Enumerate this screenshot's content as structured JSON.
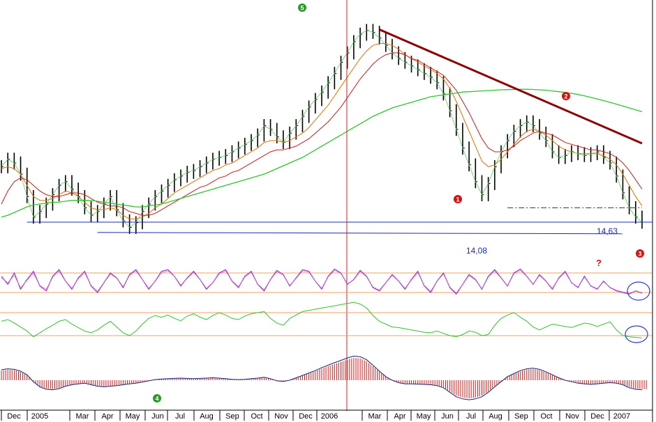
{
  "chart_data": [
    {
      "type": "line",
      "panel": "price",
      "x_axis": [
        "Dec",
        "2005",
        "Mar",
        "Apr",
        "May",
        "Jun",
        "Jul",
        "Aug",
        "Sep",
        "Oct",
        "Nov",
        "Dec",
        "2006",
        "Mar",
        "Apr",
        "May",
        "Jun",
        "Jul",
        "Aug",
        "Sep",
        "Oct",
        "Nov",
        "Dec",
        "2007"
      ],
      "series": [
        {
          "values": [
            17.6,
            18.0,
            17.8,
            17.2,
            16.0,
            14.9,
            15.2,
            15.6,
            16.1,
            16.6,
            16.8,
            16.4,
            16.0,
            15.4,
            15.0,
            15.2,
            15.6,
            16.0,
            15.3,
            14.7,
            14.35,
            14.6,
            15.2,
            15.6,
            16.0,
            16.3,
            16.6,
            16.9,
            17.1,
            17.3,
            17.4,
            17.6,
            17.8,
            18.0,
            18.1,
            18.2,
            18.4,
            18.6,
            18.8,
            19.0,
            19.3,
            19.8,
            19.6,
            19.2,
            18.9,
            19.4,
            19.8,
            20.3,
            20.8,
            21.2,
            21.6,
            22.1,
            22.6,
            23.2,
            23.7,
            24.3,
            24.7,
            24.9,
            24.8,
            24.5,
            24.1,
            23.7,
            23.4,
            23.2,
            23.0,
            22.8,
            22.6,
            22.4,
            22.1,
            21.5,
            20.6,
            19.6,
            18.6,
            17.7,
            16.8,
            16.1,
            16.7,
            17.6,
            18.4,
            19.0,
            19.5,
            19.8,
            20.0,
            19.8,
            19.4,
            19.0,
            18.4,
            18.1,
            18.2,
            18.4,
            18.3,
            18.2,
            18.3,
            18.4,
            18.1,
            17.8,
            17.1,
            16.2,
            15.4,
            14.9,
            14.63
          ]
        },
        {
          "values": [
            17.5,
            17.6,
            17.5,
            17.2,
            16.6,
            16.0,
            15.8,
            15.8,
            15.9,
            16.1,
            16.3,
            16.2,
            16.0,
            15.7,
            15.4,
            15.3,
            15.3,
            15.4,
            15.3,
            15.0,
            14.8,
            14.8,
            14.9,
            15.1,
            15.4,
            15.6,
            15.9,
            16.2,
            16.4,
            16.6,
            16.8,
            17.0,
            17.2,
            17.4,
            17.5,
            17.7,
            17.8,
            18.0,
            18.2,
            18.4,
            18.6,
            18.9,
            19.0,
            19.0,
            18.9,
            19.0,
            19.2,
            19.4,
            19.7,
            20.1,
            20.5,
            20.9,
            21.4,
            21.9,
            22.4,
            22.9,
            23.4,
            23.8,
            24.1,
            24.2,
            24.2,
            24.1,
            23.9,
            23.6,
            23.4,
            23.2,
            23.0,
            22.8,
            22.6,
            22.3,
            21.8,
            21.1,
            20.3,
            19.5,
            18.7,
            17.9,
            17.6,
            17.7,
            18.0,
            18.4,
            18.8,
            19.2,
            19.5,
            19.6,
            19.5,
            19.3,
            19.0,
            18.7,
            18.5,
            18.4,
            18.3,
            18.3,
            18.3,
            18.3,
            18.2,
            18.0,
            17.7,
            17.2,
            16.6,
            16.0,
            15.5
          ]
        },
        {
          "values": [
            15.6,
            16.3,
            16.8,
            17.0,
            16.9,
            16.6,
            16.3,
            16.1,
            16.0,
            16.0,
            16.1,
            16.2,
            16.2,
            16.1,
            15.9,
            15.7,
            15.6,
            15.5,
            15.5,
            15.4,
            15.2,
            15.1,
            15.0,
            15.0,
            15.1,
            15.3,
            15.5,
            15.7,
            15.9,
            16.1,
            16.3,
            16.5,
            16.6,
            16.8,
            17.0,
            17.1,
            17.3,
            17.4,
            17.6,
            17.8,
            18.0,
            18.2,
            18.4,
            18.5,
            18.5,
            18.6,
            18.7,
            18.9,
            19.1,
            19.4,
            19.7,
            20.0,
            20.4,
            20.8,
            21.3,
            21.8,
            22.3,
            22.7,
            23.1,
            23.4,
            23.6,
            23.7,
            23.7,
            23.6,
            23.4,
            23.3,
            23.1,
            22.9,
            22.7,
            22.5,
            22.1,
            21.7,
            21.1,
            20.5,
            19.8,
            19.1,
            18.6,
            18.4,
            18.4,
            18.5,
            18.7,
            19.0,
            19.2,
            19.4,
            19.5,
            19.4,
            19.3,
            19.1,
            18.9,
            18.8,
            18.7,
            18.6,
            18.5,
            18.5,
            18.4,
            18.3,
            18.1,
            17.8,
            17.4,
            16.9,
            16.4
          ]
        },
        {
          "values": [
            14.9,
            15.0,
            15.15,
            15.3,
            15.45,
            15.55,
            15.6,
            15.65,
            15.7,
            15.7,
            15.75,
            15.8,
            15.8,
            15.8,
            15.8,
            15.75,
            15.7,
            15.65,
            15.6,
            15.55,
            15.5,
            15.45,
            15.45,
            15.5,
            15.55,
            15.6,
            15.7,
            15.8,
            15.9,
            16.0,
            16.1,
            16.2,
            16.3,
            16.4,
            16.5,
            16.6,
            16.7,
            16.8,
            16.9,
            17.0,
            17.1,
            17.2,
            17.35,
            17.5,
            17.65,
            17.8,
            17.95,
            18.1,
            18.3,
            18.5,
            18.7,
            18.9,
            19.1,
            19.3,
            19.5,
            19.7,
            19.9,
            20.1,
            20.3,
            20.45,
            20.6,
            20.75,
            20.85,
            20.95,
            21.05,
            21.15,
            21.25,
            21.35,
            21.4,
            21.45,
            21.5,
            21.55,
            21.6,
            21.62,
            21.64,
            21.66,
            21.68,
            21.7,
            21.72,
            21.73,
            21.74,
            21.75,
            21.75,
            21.74,
            21.72,
            21.7,
            21.66,
            21.62,
            21.58,
            21.53,
            21.47,
            21.4,
            21.32,
            21.23,
            21.14,
            21.05,
            20.95,
            20.85,
            20.75,
            20.65,
            20.55
          ]
        }
      ],
      "ylim": [
        13.4,
        25.6
      ],
      "horizontal_levels": [
        {
          "label": "14,63",
          "value": 14.63
        },
        {
          "label": "14,08",
          "value": 14.08
        }
      ],
      "trendline": {
        "from": {
          "x_index": 59,
          "y": 24.95
        },
        "to": {
          "x_index": 100,
          "y": 18.85
        }
      },
      "support_dashed": {
        "from_x_index": 79,
        "to_x_index": 100,
        "y": 15.4
      },
      "annotations": [
        {
          "label": "1",
          "kind": "red-marker"
        },
        {
          "label": "2",
          "kind": "red-marker"
        },
        {
          "label": "3",
          "kind": "red-marker"
        },
        {
          "label": "5",
          "kind": "green-marker"
        },
        {
          "label": "?",
          "kind": "red-text"
        }
      ]
    },
    {
      "type": "line",
      "panel": "stochastic",
      "ylim": [
        0,
        100
      ],
      "reference_levels": [
        80,
        20
      ],
      "series": [
        {
          "values": [
            70,
            45,
            80,
            30,
            60,
            85,
            40,
            25,
            70,
            90,
            55,
            30,
            65,
            85,
            40,
            20,
            50,
            80,
            65,
            35,
            75,
            90,
            60,
            30,
            55,
            85,
            90,
            70,
            40,
            65,
            85,
            60,
            30,
            50,
            80,
            90,
            55,
            35,
            70,
            85,
            45,
            25,
            60,
            88,
            75,
            40,
            65,
            90,
            85,
            55,
            30,
            70,
            92,
            80,
            45,
            60,
            88,
            70,
            35,
            25,
            50,
            75,
            55,
            30,
            60,
            85,
            40,
            20,
            55,
            80,
            35,
            15,
            45,
            75,
            60,
            30,
            70,
            90,
            65,
            40,
            80,
            92,
            70,
            45,
            75,
            55,
            30,
            65,
            85,
            50,
            35,
            70,
            40,
            30,
            55,
            35,
            25,
            20,
            15,
            25,
            18
          ]
        },
        {
          "values": [
            65,
            50,
            72,
            35,
            57,
            78,
            42,
            30,
            66,
            85,
            55,
            33,
            62,
            80,
            42,
            24,
            50,
            76,
            64,
            38,
            72,
            86,
            60,
            33,
            54,
            81,
            86,
            70,
            43,
            63,
            81,
            60,
            33,
            50,
            77,
            86,
            56,
            38,
            67,
            81,
            46,
            29,
            59,
            84,
            73,
            42,
            63,
            86,
            82,
            55,
            33,
            68,
            88,
            78,
            47,
            59,
            84,
            68,
            37,
            28,
            50,
            72,
            55,
            33,
            58,
            81,
            42,
            24,
            54,
            77,
            37,
            19,
            45,
            72,
            58,
            32,
            67,
            86,
            64,
            41,
            77,
            88,
            69,
            46,
            72,
            54,
            33,
            63,
            81,
            50,
            37,
            67,
            41,
            32,
            53,
            36,
            27,
            22,
            18,
            24,
            20
          ]
        }
      ]
    },
    {
      "type": "line",
      "panel": "rsi",
      "ylim": [
        0,
        100
      ],
      "reference_levels": [
        70,
        30
      ],
      "series": [
        {
          "values": [
            55,
            58,
            52,
            45,
            38,
            28,
            35,
            42,
            48,
            55,
            58,
            50,
            44,
            38,
            35,
            40,
            48,
            55,
            45,
            35,
            30,
            38,
            50,
            60,
            65,
            62,
            66,
            60,
            56,
            64,
            68,
            62,
            58,
            65,
            70,
            66,
            60,
            58,
            64,
            68,
            70,
            72,
            60,
            52,
            48,
            60,
            66,
            72,
            74,
            76,
            78,
            80,
            82,
            84,
            86,
            88,
            85,
            78,
            65,
            55,
            50,
            45,
            44,
            42,
            40,
            38,
            36,
            35,
            38,
            34,
            30,
            28,
            32,
            38,
            36,
            30,
            32,
            48,
            60,
            66,
            70,
            62,
            55,
            45,
            40,
            45,
            50,
            48,
            46,
            44,
            48,
            52,
            50,
            46,
            50,
            54,
            40,
            30,
            28,
            27,
            26
          ]
        }
      ]
    },
    {
      "type": "bar",
      "panel": "macd",
      "ylim": [
        -1,
        1
      ],
      "series": [
        {
          "values": [
            0.35,
            0.38,
            0.36,
            0.3,
            0.18,
            -0.05,
            -0.22,
            -0.3,
            -0.32,
            -0.28,
            -0.2,
            -0.15,
            -0.12,
            -0.1,
            -0.15,
            -0.2,
            -0.22,
            -0.2,
            -0.18,
            -0.15,
            -0.12,
            -0.1,
            -0.06,
            -0.02,
            0.02,
            0.04,
            0.05,
            0.06,
            0.07,
            0.06,
            0.05,
            0.06,
            0.07,
            0.08,
            0.07,
            0.05,
            0.03,
            0.02,
            0.03,
            0.05,
            0.07,
            0.1,
            0.05,
            -0.02,
            -0.04,
            0.0,
            0.08,
            0.16,
            0.24,
            0.32,
            0.42,
            0.5,
            0.58,
            0.66,
            0.74,
            0.8,
            0.78,
            0.68,
            0.5,
            0.3,
            0.12,
            0.0,
            -0.08,
            -0.12,
            -0.12,
            -0.13,
            -0.14,
            -0.15,
            -0.18,
            -0.25,
            -0.4,
            -0.55,
            -0.62,
            -0.65,
            -0.62,
            -0.55,
            -0.4,
            -0.22,
            -0.05,
            0.12,
            0.22,
            0.32,
            0.38,
            0.4,
            0.36,
            0.28,
            0.18,
            0.08,
            0.0,
            -0.05,
            -0.1,
            -0.12,
            -0.14,
            -0.12,
            -0.1,
            -0.08,
            -0.1,
            -0.15,
            -0.25,
            -0.3,
            -0.32
          ]
        }
      ]
    }
  ]
}
